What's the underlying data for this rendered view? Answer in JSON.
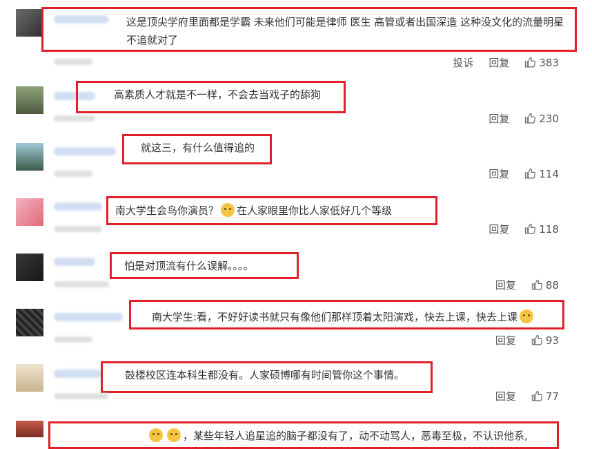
{
  "action_labels": {
    "report": "投诉",
    "reply": "回复"
  },
  "colors": {
    "highlight": "#e0202a",
    "username_blur": "#c9d9f0",
    "text": "#333333"
  },
  "comments": [
    {
      "text": "这是顶尖学府里面都是学霸 未来他们可能是律师 医生 高管或者出国深造 这种没文化的流量明星 不追就对了",
      "likes": "383",
      "has_report": true
    },
    {
      "text": "高素质人才就是不一样，不会去当戏子的舔狗",
      "likes": "230"
    },
    {
      "text": "就这三，有什么值得追的",
      "likes": "114"
    },
    {
      "text_before": "南大学生会鸟你演员？",
      "emoji": "thinking-face-emoji",
      "text_after": "在人家眼里你比人家低好几个等级",
      "likes": "118"
    },
    {
      "text": "怕是对顶流有什么误解。。。。",
      "likes": "88"
    },
    {
      "text": "南大学生:看，不好好读书就只有像他们那样顶着太阳演戏，快去上课，快去上课",
      "emoji": "cat-face-emoji",
      "likes": "93"
    },
    {
      "text": "鼓楼校区连本科生都没有。人家硕博哪有时间管你这个事情。",
      "likes": "77"
    },
    {
      "text": "，某些年轻人追星追的脑子都没有了，动不动骂人，恶毒至极，不认识他系,",
      "emoji": "thumbs-up-emoji"
    }
  ]
}
